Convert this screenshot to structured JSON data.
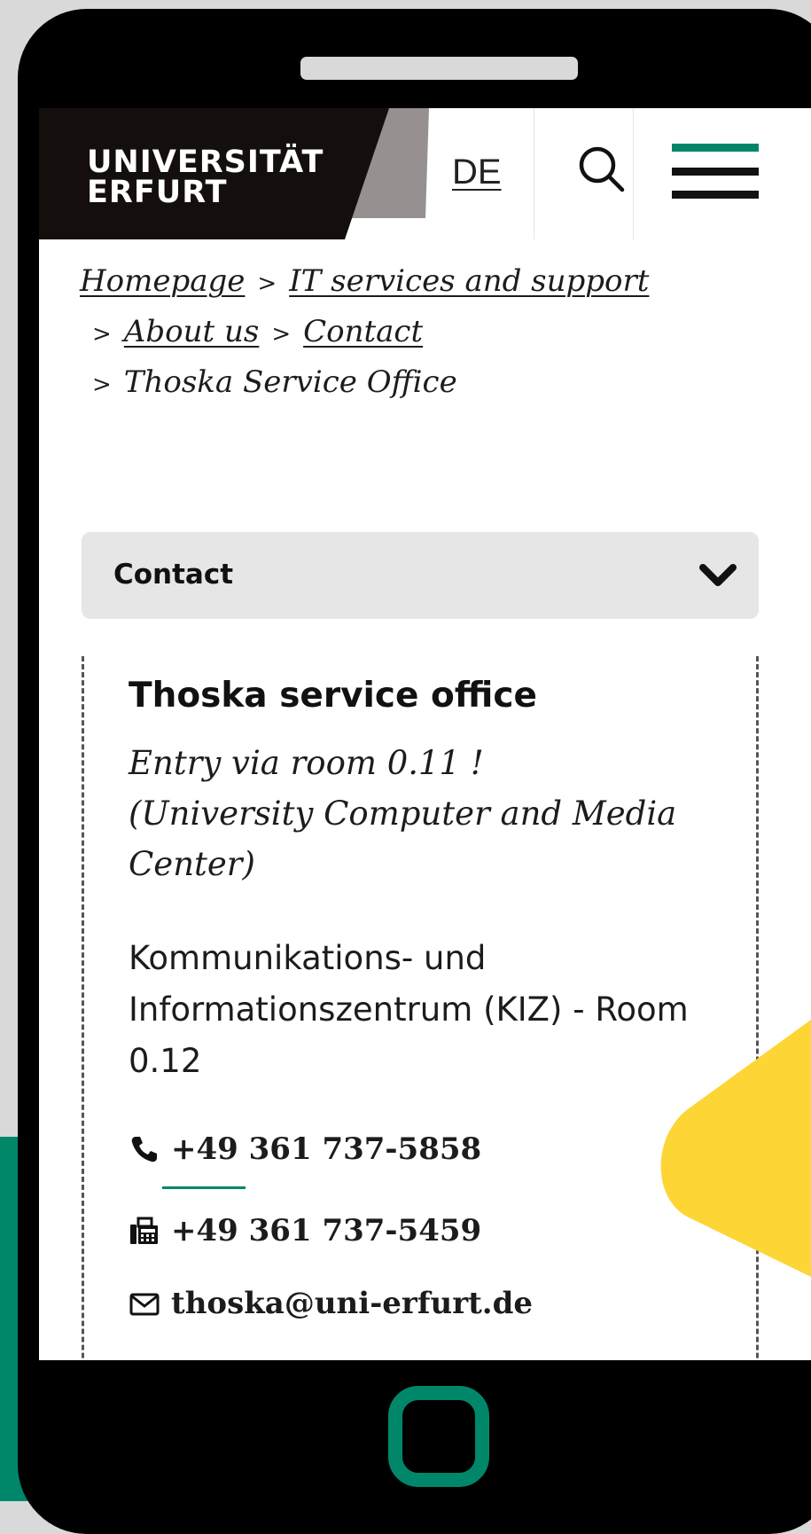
{
  "colors": {
    "brand_green": "#00876a",
    "brand_black": "#140f0d",
    "logo_grey": "#969090",
    "accent_yellow": "#fdd535",
    "background": "#d9d9d9"
  },
  "header": {
    "logo_line1": "UNIVERSITÄT",
    "logo_line2": "ERFURT",
    "language": "DE",
    "search_icon": "search-icon",
    "menu_icon": "hamburger-icon"
  },
  "breadcrumb": {
    "items": [
      "Homepage",
      "IT services and support",
      "About us",
      "Contact"
    ],
    "current": "Thoska Service Office",
    "separator": ">"
  },
  "accordion": {
    "title": "Contact",
    "icon": "chevron-down-icon"
  },
  "contact": {
    "title": "Thoska service office",
    "note_line1": "Entry via room 0.11 !",
    "note_line2": "(University Computer and Media",
    "note_line3": "Center)",
    "address_line1": "Kommunikations- und",
    "address_line2": "Informationszentrum (KIZ) - Room",
    "address_line3": "0.12",
    "phone": "+49 361 737-5858",
    "fax": "+49 361 737-5459",
    "email": "thoska@uni-erfurt.de"
  }
}
